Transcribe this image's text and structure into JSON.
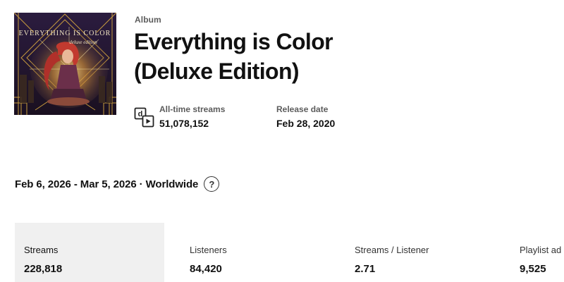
{
  "album": {
    "type_label": "Album",
    "title_line1": "Everything is Color",
    "title_line2": "(Deluxe Edition)",
    "cover_text": "EVERYTHING IS COLOR",
    "cover_subtext": "deluxe edition"
  },
  "stats": {
    "all_time_streams_label": "All-time streams",
    "all_time_streams_value": "51,078,152",
    "release_date_label": "Release date",
    "release_date_value": "Feb 28, 2020"
  },
  "filter": {
    "range_text": "Feb 6, 2026 - Mar 5, 2026 · Worldwide",
    "help_symbol": "?"
  },
  "metrics": [
    {
      "label": "Streams",
      "value": "228,818",
      "active": true
    },
    {
      "label": "Listeners",
      "value": "84,420",
      "active": false
    },
    {
      "label": "Streams / Listener",
      "value": "2.71",
      "active": false
    },
    {
      "label": "Playlist ad",
      "value": "9,525",
      "active": false
    }
  ],
  "colors": {
    "active_metric_bg": "#f0f0f0",
    "text_primary": "#111111",
    "text_secondary": "#5c5c5c",
    "cover_bg": "#241634",
    "cover_gold": "#d9a93f",
    "cover_hair": "#b0302a"
  },
  "icons": {
    "streams": "streams-icon",
    "help": "question-circle-icon"
  }
}
